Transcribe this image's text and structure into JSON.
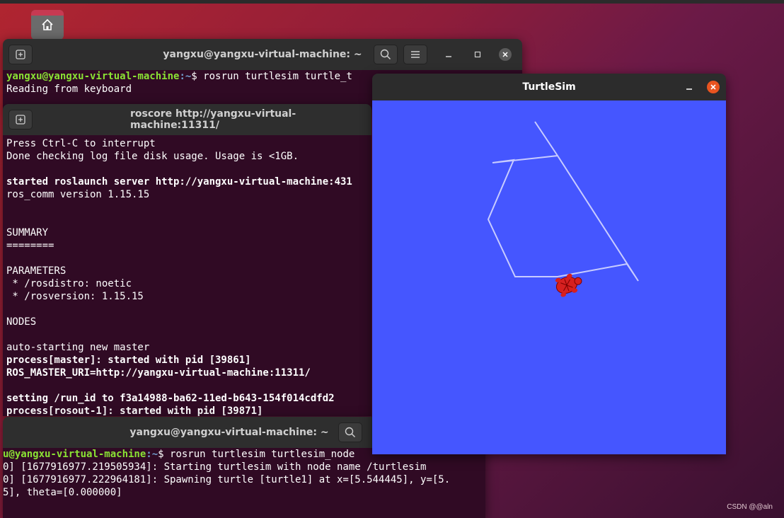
{
  "colors": {
    "desktop_accent": "#b02530",
    "terminal_bg": "#300a24",
    "prompt_user": "#8ae234",
    "prompt_path": "#729fcf",
    "turtlesim_bg": "#4556ff",
    "close_button": "#e95420"
  },
  "desktop": {
    "home_icon": "home-icon",
    "watermark": "CSDN @@aln"
  },
  "terminal1": {
    "title": "yangxu@yangxu-virtual-machine: ~",
    "prompt_user": "yangxu@yangxu-virtual-machine",
    "prompt_path": ":~",
    "command": "$ rosrun turtlesim turtle_t",
    "output": "Reading from keyboard"
  },
  "terminal2": {
    "title": "roscore http://yangxu-virtual-machine:11311/",
    "lines": [
      {
        "text": "Press Ctrl-C to interrupt",
        "bold": false
      },
      {
        "text": "Done checking log file disk usage. Usage is <1GB.",
        "bold": false
      },
      {
        "text": "",
        "bold": false
      },
      {
        "text": "started roslaunch server http://yangxu-virtual-machine:431",
        "bold": true
      },
      {
        "text": "ros_comm version 1.15.15",
        "bold": false
      },
      {
        "text": "",
        "bold": false
      },
      {
        "text": "",
        "bold": false
      },
      {
        "text": "SUMMARY",
        "bold": false
      },
      {
        "text": "========",
        "bold": false
      },
      {
        "text": "",
        "bold": false
      },
      {
        "text": "PARAMETERS",
        "bold": false
      },
      {
        "text": " * /rosdistro: noetic",
        "bold": false
      },
      {
        "text": " * /rosversion: 1.15.15",
        "bold": false
      },
      {
        "text": "",
        "bold": false
      },
      {
        "text": "NODES",
        "bold": false
      },
      {
        "text": "",
        "bold": false
      },
      {
        "text": "auto-starting new master",
        "bold": false
      },
      {
        "text": "process[master]: started with pid [39861]",
        "bold": true
      },
      {
        "text": "ROS_MASTER_URI=http://yangxu-virtual-machine:11311/",
        "bold": true
      },
      {
        "text": "",
        "bold": false
      },
      {
        "text": "setting /run_id to f3a14988-ba62-11ed-b643-154f014cdfd2",
        "bold": true
      },
      {
        "text": "process[rosout-1]: started with pid [39871]",
        "bold": true
      }
    ]
  },
  "terminal3": {
    "title": "yangxu@yangxu-virtual-machine: ~",
    "prompt_user": "u@yangxu-virtual-machine",
    "prompt_path": ":~",
    "command": "$ rosrun turtlesim turtlesim_node",
    "lines": [
      "0] [1677916977.219505934]: Starting turtlesim with node name /turtlesim",
      "0] [1677916977.222964181]: Spawning turtle [turtle1] at x=[5.544445], y=[5.",
      "5], theta=[0.000000]"
    ]
  },
  "turtlesim": {
    "title": "TurtleSim"
  }
}
